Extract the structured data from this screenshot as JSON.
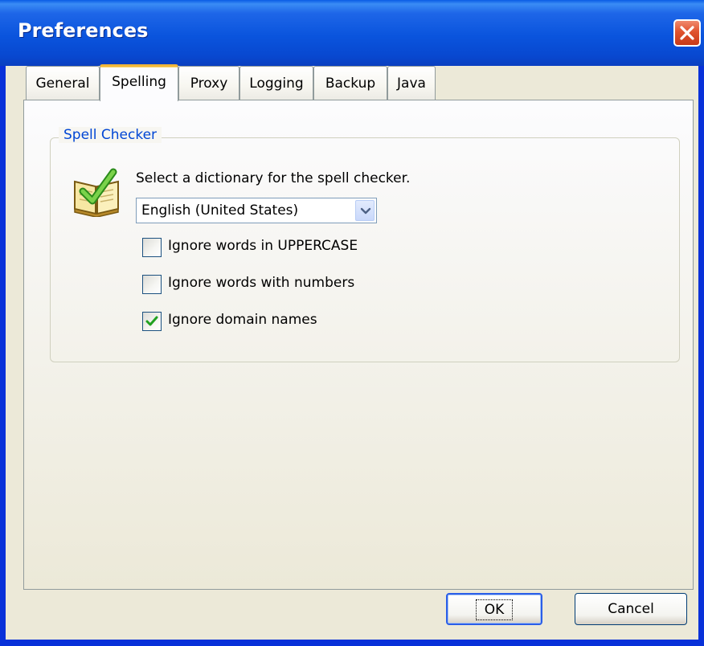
{
  "window": {
    "title": "Preferences"
  },
  "tabs": [
    {
      "label": "General",
      "active": false
    },
    {
      "label": "Spelling",
      "active": true
    },
    {
      "label": "Proxy",
      "active": false
    },
    {
      "label": "Logging",
      "active": false
    },
    {
      "label": "Backup",
      "active": false
    },
    {
      "label": "Java",
      "active": false
    }
  ],
  "spell_checker": {
    "group_title": "Spell Checker",
    "prompt": "Select a dictionary for the spell checker.",
    "dictionary": {
      "selected": "English (United States)"
    },
    "options": [
      {
        "label": "Ignore words in UPPERCASE",
        "checked": false
      },
      {
        "label": "Ignore words with numbers",
        "checked": false
      },
      {
        "label": "Ignore domain names",
        "checked": true
      }
    ]
  },
  "buttons": {
    "ok": "OK",
    "cancel": "Cancel"
  },
  "colors": {
    "titlebar": "#0a54dd",
    "dialog_face": "#ece9d8",
    "group_title": "#0046d5",
    "active_tab_accent": "#f1b63a",
    "checkmark": "#21a121"
  },
  "icons": {
    "close": "close-icon",
    "spell_book": "spell-check-book-icon",
    "dropdown": "chevron-down-icon",
    "check": "checkmark-icon"
  }
}
